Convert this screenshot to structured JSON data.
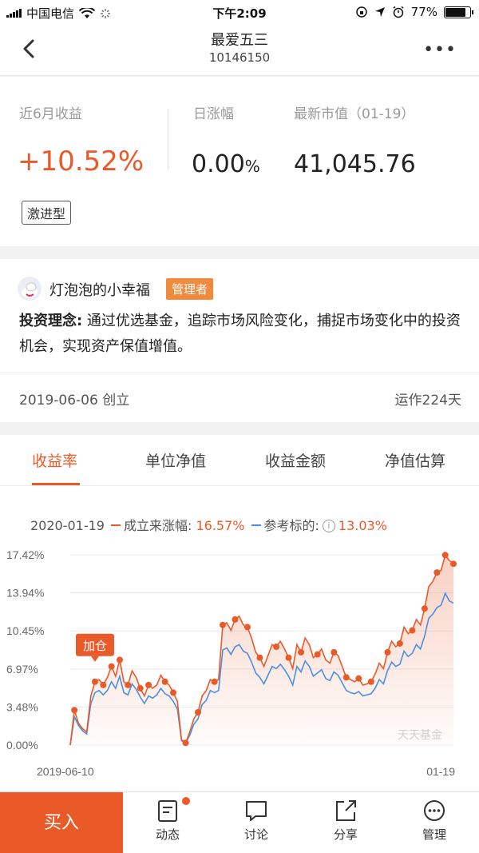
{
  "status_bar": {
    "carrier": "中国电信",
    "time": "下午2:09",
    "battery": "77%"
  },
  "nav": {
    "title": "最爱五三",
    "code": "10146150"
  },
  "summary": {
    "return_label": "近6月收益",
    "return_value": "+10.52%",
    "daily_label": "日涨幅",
    "daily_value": "0.00",
    "daily_unit": "%",
    "market_label": "最新市值（01-19）",
    "market_value": "41,045.76",
    "risk_tag": "激进型"
  },
  "manager": {
    "name": "灯泡泡的小幸福",
    "badge": "管理者",
    "philosophy_label": "投资理念:",
    "philosophy_text": " 通过优选基金，追踪市场风险变化，捕捉市场变化中的投资机会，实现资产保值增值。",
    "founded": "2019-06-06 创立",
    "running": "运作224天"
  },
  "tabs": [
    {
      "label": "收益率",
      "active": true
    },
    {
      "label": "单位净值",
      "active": false
    },
    {
      "label": "收益金额",
      "active": false
    },
    {
      "label": "净值估算",
      "active": false
    }
  ],
  "legend": {
    "date": "2020-01-19",
    "series1_label": "成立来涨幅:",
    "series1_value": "16.57%",
    "series2_label": "参考标的:",
    "series2_value": "13.03%"
  },
  "chart_data": {
    "type": "line",
    "x_start": "2019-06-10",
    "x_end": "01-19",
    "yticks": [
      "17.42%",
      "13.94%",
      "10.45%",
      "6.97%",
      "3.48%",
      "0.00%"
    ],
    "ylim": [
      0,
      17.42
    ],
    "watermark": "天天基金",
    "annotation": "加仓",
    "grid": true,
    "series": [
      {
        "name": "成立来涨幅",
        "color": "#ea5a28",
        "values": [
          0.0,
          3.2,
          2.0,
          1.5,
          1.2,
          4.5,
          5.8,
          6.0,
          5.5,
          6.2,
          7.2,
          6.3,
          7.8,
          5.8,
          5.5,
          6.8,
          6.2,
          5.2,
          4.5,
          5.5,
          5.2,
          5.5,
          6.4,
          5.8,
          5.5,
          4.8,
          4.0,
          0.5,
          0.2,
          1.2,
          2.4,
          3.0,
          4.5,
          5.0,
          6.0,
          5.8,
          6.0,
          11.0,
          11.2,
          10.5,
          11.5,
          11.8,
          11.0,
          10.8,
          9.8,
          8.5,
          8.0,
          7.2,
          8.2,
          9.2,
          9.0,
          9.5,
          8.8,
          8.0,
          7.0,
          9.2,
          8.5,
          9.8,
          9.2,
          8.0,
          8.3,
          8.8,
          7.8,
          7.5,
          8.5,
          8.2,
          7.2,
          6.2,
          6.0,
          5.8,
          6.1,
          5.5,
          5.6,
          5.8,
          6.5,
          7.5,
          7.0,
          8.5,
          9.5,
          9.0,
          9.3,
          10.8,
          10.2,
          10.5,
          11.5,
          11.0,
          12.5,
          14.5,
          15.0,
          15.8,
          16.0,
          17.4,
          16.9,
          16.6
        ]
      },
      {
        "name": "参考标的",
        "color": "#4a90e2",
        "values": [
          0.0,
          2.6,
          1.8,
          1.3,
          1.0,
          3.8,
          4.8,
          5.0,
          4.6,
          5.0,
          5.8,
          5.2,
          6.3,
          4.8,
          4.6,
          5.6,
          5.1,
          4.4,
          3.8,
          4.5,
          4.3,
          4.6,
          5.2,
          4.7,
          4.5,
          4.0,
          3.3,
          0.4,
          0.2,
          0.9,
          1.9,
          2.4,
          3.7,
          4.1,
          5.0,
          4.8,
          5.0,
          8.7,
          8.9,
          8.3,
          9.0,
          9.2,
          8.6,
          8.4,
          7.6,
          6.6,
          6.2,
          5.6,
          6.4,
          7.2,
          7.0,
          7.4,
          6.9,
          6.3,
          5.5,
          7.2,
          6.7,
          7.7,
          7.2,
          6.3,
          6.6,
          6.9,
          6.1,
          5.9,
          6.7,
          6.4,
          5.7,
          5.0,
          4.8,
          4.7,
          4.9,
          4.5,
          4.6,
          4.7,
          5.2,
          6.0,
          5.6,
          6.8,
          7.6,
          7.2,
          7.4,
          8.6,
          8.1,
          8.4,
          9.2,
          8.8,
          10.0,
          11.6,
          12.0,
          12.6,
          12.8,
          13.9,
          13.2,
          13.0
        ]
      }
    ],
    "buy_markers_at_index": [
      1,
      6,
      8,
      10,
      12,
      14,
      17,
      19,
      23,
      25,
      28,
      31,
      35,
      37,
      40,
      43,
      46,
      50,
      53,
      56,
      60,
      64,
      67,
      70,
      73,
      77,
      80,
      83,
      86,
      89,
      91,
      93
    ]
  },
  "bottom": {
    "buy": "买入",
    "items": [
      {
        "label": "动态",
        "icon": "feed-icon",
        "badge": true
      },
      {
        "label": "讨论",
        "icon": "chat-icon",
        "badge": false
      },
      {
        "label": "分享",
        "icon": "share-icon",
        "badge": false
      },
      {
        "label": "管理",
        "icon": "manage-icon",
        "badge": false
      }
    ]
  }
}
